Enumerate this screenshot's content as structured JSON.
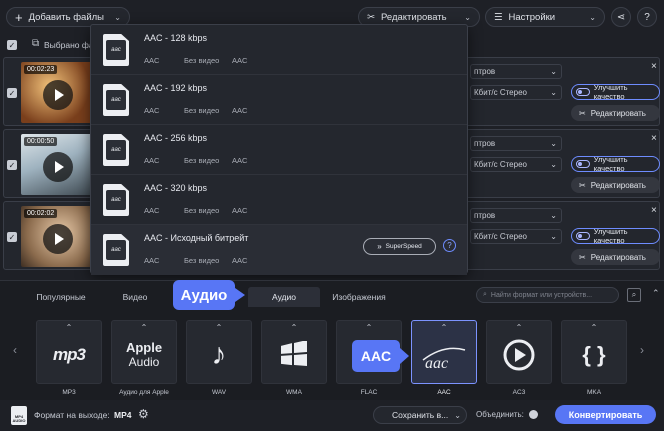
{
  "toolbar": {
    "add_files": "Добавить файлы",
    "edit": "Редактировать",
    "settings": "Настройки"
  },
  "select_all": {
    "label": "Выбрано фай"
  },
  "files": [
    {
      "duration": "00:02:23",
      "format_sel": "птров",
      "audio_sel": "Кбит/с Стерео",
      "enhance": "Улучшить качество",
      "edit": "Редактировать"
    },
    {
      "duration": "00:00:50",
      "format_sel": "птров",
      "audio_sel": "Кбит/с Стерео",
      "enhance": "Улучшить качество",
      "edit": "Редактировать"
    },
    {
      "duration": "00:02:02",
      "format_sel": "птров",
      "audio_sel": "Кбит/с Стерео",
      "enhance": "Улучшить качество",
      "edit": "Редактировать"
    }
  ],
  "popup": {
    "items": [
      {
        "title": "AAC - 128 kbps",
        "fmt": "AAC",
        "video": "Без видео",
        "codec": "AAC",
        "icon": "aac"
      },
      {
        "title": "AAC - 192 kbps",
        "fmt": "AAC",
        "video": "Без видео",
        "codec": "AAC",
        "icon": "aac"
      },
      {
        "title": "AAC - 256 kbps",
        "fmt": "AAC",
        "video": "Без видео",
        "codec": "AAC",
        "icon": "aac"
      },
      {
        "title": "AAC - 320 kbps",
        "fmt": "AAC",
        "video": "Без видео",
        "codec": "AAC",
        "icon": "aac"
      },
      {
        "title": "AAC - Исходный битрейт",
        "fmt": "AAC",
        "video": "Без видео",
        "codec": "AAC",
        "icon": "aac"
      }
    ],
    "superspeed": "SuperSpeed",
    "help": "?"
  },
  "format_panel": {
    "tabs": [
      "Популярные",
      "Видео",
      "Аудио",
      "Изображения"
    ],
    "callout_audio": "Аудио",
    "callout_aac": "AAC",
    "search_placeholder": "Найти формат или устройств...",
    "tiles": [
      {
        "label": "MP3",
        "logo": "mp3"
      },
      {
        "label": "Аудио для Apple",
        "logo_top": "Apple",
        "logo_bottom": "Audio"
      },
      {
        "label": "WAV",
        "logo": "♪"
      },
      {
        "label": "WMA",
        "logo": "wma"
      },
      {
        "label": "FLAC",
        "logo": "flac"
      },
      {
        "label": "AAC",
        "logo": "aac"
      },
      {
        "label": "AC3",
        "logo": "ac3"
      },
      {
        "label": "MKA",
        "logo": "{ }"
      }
    ]
  },
  "bottom": {
    "output_label": "Формат на выходе:",
    "output_value": "MP4",
    "output_icon_text": "MP4 AUDIO",
    "save_to": "Сохранить в...",
    "merge": "Объединить:",
    "convert": "Конвертировать"
  },
  "colors": {
    "accent": "#5876f5",
    "panel": "#24272e",
    "bg": "#1e2026"
  }
}
